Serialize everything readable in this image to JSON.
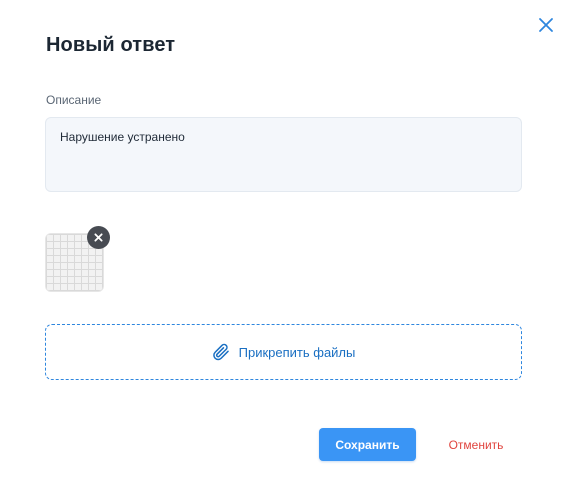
{
  "dialog": {
    "title": "Новый ответ",
    "close_icon": "close-icon"
  },
  "description": {
    "label": "Описание",
    "value": "Нарушение устранено"
  },
  "attachments": [
    {
      "type": "image",
      "remove_icon": "close-icon"
    }
  ],
  "attach": {
    "label": "Прикрепить файлы",
    "icon": "paperclip-icon"
  },
  "actions": {
    "save_label": "Сохранить",
    "cancel_label": "Отменить"
  },
  "colors": {
    "accent": "#3a95f5",
    "link": "#1a6fc2",
    "danger": "#e0443e",
    "field_bg": "#f4f7fb"
  }
}
